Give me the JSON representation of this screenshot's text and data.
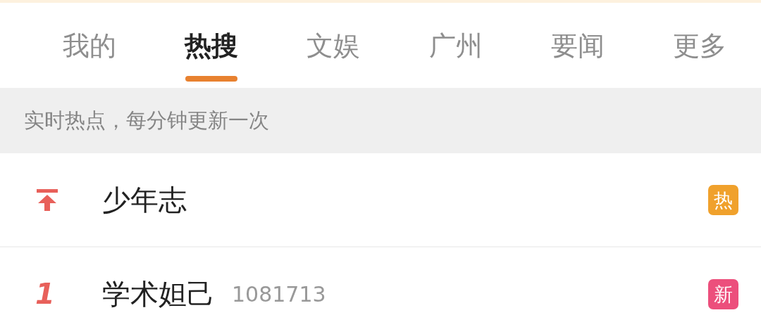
{
  "tabs": [
    {
      "label": "我的",
      "selected": false
    },
    {
      "label": "热搜",
      "selected": true
    },
    {
      "label": "文娱",
      "selected": false
    },
    {
      "label": "广州",
      "selected": false
    },
    {
      "label": "要闻",
      "selected": false
    },
    {
      "label": "更多",
      "selected": false
    }
  ],
  "notice": "实时热点，每分钟更新一次",
  "items": [
    {
      "kind": "pinned",
      "title": "少年志",
      "badge": {
        "label": "热",
        "color": "#f0a12c"
      }
    },
    {
      "kind": "ranked",
      "rank": "1",
      "title": "学术妲己",
      "count": "1081713",
      "badge": {
        "label": "新",
        "color": "#ec4f7c"
      }
    }
  ]
}
